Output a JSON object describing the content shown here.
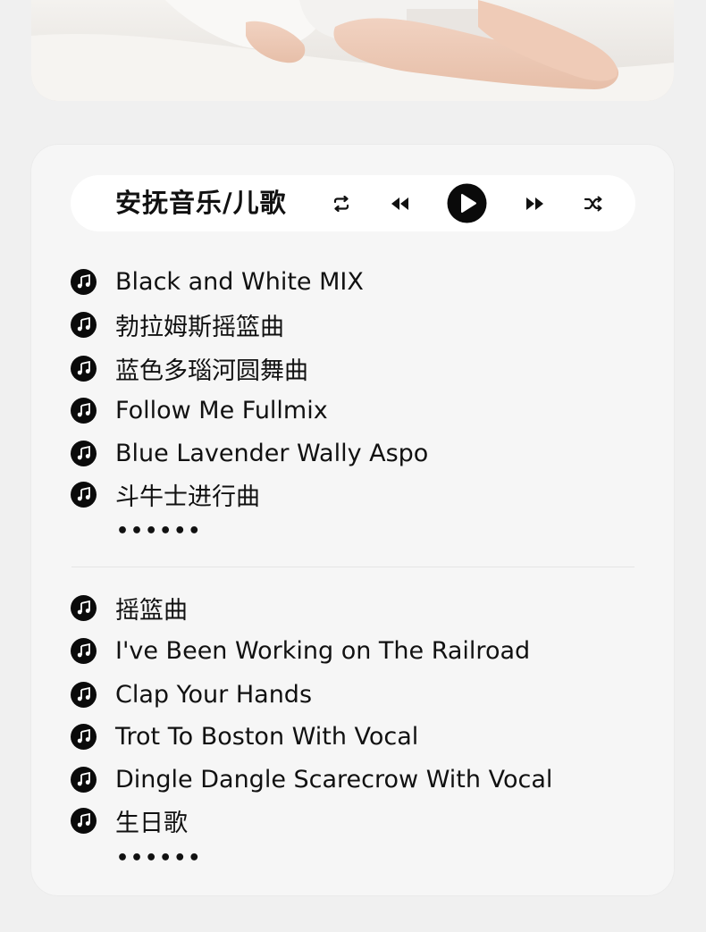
{
  "player": {
    "title": "安抚音乐/儿歌",
    "controls": [
      "repeat-icon",
      "rewind-icon",
      "play-icon",
      "fast-forward-icon",
      "shuffle-icon"
    ]
  },
  "playlist_1": {
    "tracks": [
      "Black and White MIX",
      "勃拉姆斯摇篮曲",
      "蓝色多瑙河圆舞曲",
      "Follow Me Fullmix",
      "Blue Lavender Wally Aspo",
      "斗牛士进行曲"
    ],
    "more": "••••••"
  },
  "playlist_2": {
    "tracks": [
      "摇篮曲",
      "I've Been Working on The Railroad",
      "Clap Your Hands",
      "Trot To Boston With Vocal",
      "Dingle Dangle Scarecrow With Vocal",
      "生日歌"
    ],
    "more": "••••••"
  },
  "colors": {
    "background": "#f0f0f0",
    "card": "#f6f6f6",
    "player_bar": "#ffffff",
    "text": "#111111"
  }
}
